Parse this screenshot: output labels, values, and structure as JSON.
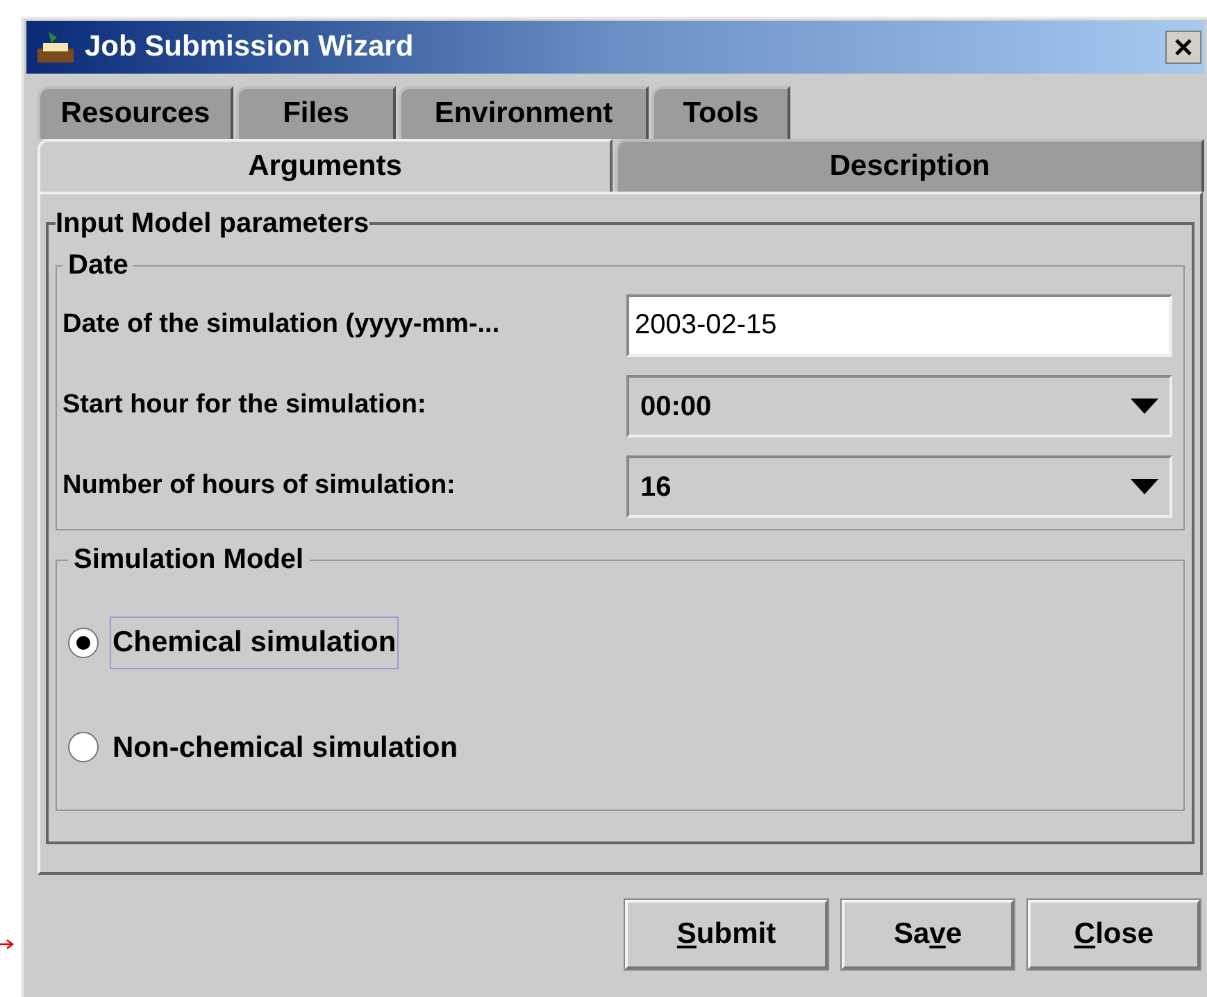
{
  "window": {
    "title": "Job Submission Wizard"
  },
  "tab_rows": [
    [
      {
        "label": "Resources",
        "selected": false
      },
      {
        "label": "Files",
        "selected": false
      },
      {
        "label": "Environment",
        "selected": false
      },
      {
        "label": "Tools",
        "selected": false
      }
    ],
    [
      {
        "label": "Arguments",
        "selected": true
      },
      {
        "label": "Description",
        "selected": false
      }
    ]
  ],
  "parameters": {
    "title": "Input Model parameters",
    "date_group": {
      "title": "Date",
      "fields": [
        {
          "kind": "text",
          "label": "Date of the simulation (yyyy-mm-...",
          "value": "2003-02-15"
        },
        {
          "kind": "dropdown",
          "label": "Start hour for the simulation:",
          "value": "00:00"
        },
        {
          "kind": "dropdown",
          "label": "Number of hours of simulation:",
          "value": "16"
        }
      ]
    },
    "model_group": {
      "title": "Simulation Model",
      "options": [
        {
          "label": "Chemical simulation",
          "selected": true,
          "focused": true
        },
        {
          "label": "Non-chemical simulation",
          "selected": false,
          "focused": false
        }
      ]
    }
  },
  "buttons": [
    {
      "label_parts": [
        {
          "text": "S",
          "underlined": true
        },
        {
          "text": "ubmit",
          "underlined": false
        }
      ]
    },
    {
      "label_parts": [
        {
          "text": "Sa",
          "underlined": false
        },
        {
          "text": "v",
          "underlined": true
        },
        {
          "text": "e",
          "underlined": false
        }
      ]
    },
    {
      "label_parts": [
        {
          "text": "C",
          "underlined": true
        },
        {
          "text": "lose",
          "underlined": false
        }
      ]
    }
  ]
}
